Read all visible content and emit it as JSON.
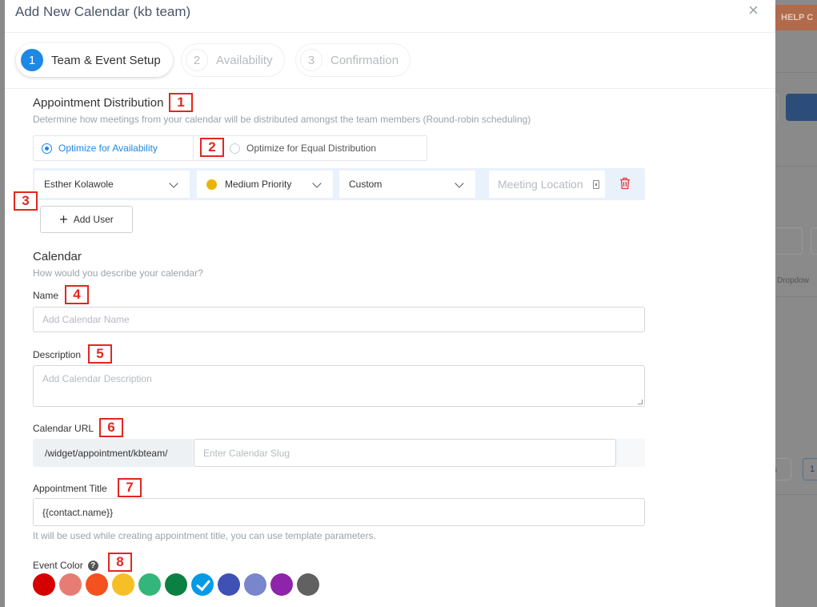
{
  "background": {
    "help_label": "HELP C",
    "dropdown_text": "Dropdow",
    "small_text": "s",
    "page_num": "1"
  },
  "modal": {
    "title": "Add New Calendar (kb team)",
    "close_icon": "×"
  },
  "steps": [
    {
      "num": "1",
      "label": "Team & Event Setup",
      "active": true
    },
    {
      "num": "2",
      "label": "Availability",
      "active": false
    },
    {
      "num": "3",
      "label": "Confirmation",
      "active": false
    }
  ],
  "distribution": {
    "title": "Appointment Distribution",
    "subtitle": "Determine how meetings from your calendar will be distributed amongst the team members (Round-robin scheduling)",
    "options": [
      {
        "label": "Optimize for Availability",
        "selected": true
      },
      {
        "label": "Optimize for Equal Distribution",
        "selected": false
      }
    ]
  },
  "member": {
    "name": "Esther Kolawole",
    "priority": "Medium Priority",
    "priority_color": "#eab308",
    "meeting_type": "Custom",
    "location_placeholder": "Meeting Location"
  },
  "add_user_label": "Add User",
  "calendar": {
    "title": "Calendar",
    "subtitle": "How would you describe your calendar?",
    "name_label": "Name",
    "name_placeholder": "Add Calendar Name",
    "description_label": "Description",
    "description_placeholder": "Add Calendar Description",
    "url_label": "Calendar URL",
    "url_prefix": "/widget/appointment/kbteam/",
    "slug_placeholder": "Enter Calendar Slug",
    "appointment_title_label": "Appointment Title",
    "appointment_title_value": "{{contact.name}}",
    "appointment_title_help": "It will be used while creating appointment title, you can use template parameters.",
    "event_color_label": "Event Color"
  },
  "event_colors": [
    "#d50000",
    "#e67c73",
    "#f4511e",
    "#f6bf26",
    "#33b679",
    "#0b8043",
    "#039be5",
    "#3f51b5",
    "#7986cb",
    "#8e24aa",
    "#616161"
  ],
  "selected_color_index": 6,
  "markers": [
    "1",
    "2",
    "3",
    "4",
    "5",
    "6",
    "7",
    "8"
  ]
}
